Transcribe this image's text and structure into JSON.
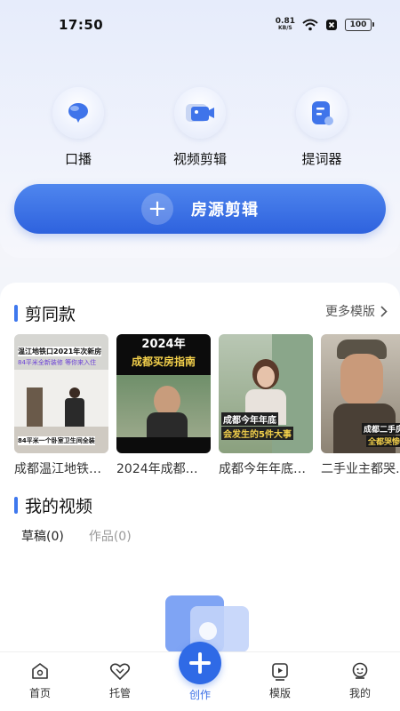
{
  "status": {
    "time": "17:50",
    "net_speed": "0.81",
    "net_unit": "KB/S",
    "battery": "100"
  },
  "tools": [
    {
      "label": "口播",
      "icon": "mic-bubble-icon"
    },
    {
      "label": "视频剪辑",
      "icon": "video-camera-icon"
    },
    {
      "label": "提词器",
      "icon": "teleprompter-icon"
    }
  ],
  "main_action": {
    "label": "房源剪辑",
    "icon": "plus-icon"
  },
  "templates_section": {
    "title": "剪同款",
    "more_label": "更多模版",
    "items": [
      {
        "title": "成都温江地铁…",
        "overlay_lines": [
          "温江地铁口2021年次新房",
          "84平米全新装修 等你来入住",
          "84平米一个卧室卫生间全装"
        ]
      },
      {
        "title": "2024年成都…",
        "overlay_lines": [
          "2024年",
          "成都买房指南"
        ]
      },
      {
        "title": "成都今年年底…",
        "overlay_lines": [
          "成都今年年底",
          "会发生的5件大事"
        ]
      },
      {
        "title": "二手业主都哭…",
        "overlay_lines": [
          "成都二手房东",
          "全都哭惨了"
        ]
      }
    ]
  },
  "videos_section": {
    "title": "我的视频",
    "tabs": [
      {
        "label": "草稿(0)",
        "active": true
      },
      {
        "label": "作品(0)",
        "active": false
      }
    ]
  },
  "nav": {
    "items": [
      {
        "label": "首页",
        "icon": "home-icon"
      },
      {
        "label": "托管",
        "icon": "handshake-icon"
      },
      {
        "label": "创作",
        "icon": "create-plus-icon",
        "active": true
      },
      {
        "label": "模版",
        "icon": "template-play-icon"
      },
      {
        "label": "我的",
        "icon": "profile-icon"
      }
    ]
  },
  "colors": {
    "accent": "#2f6ae6",
    "panel_bg": "#ffffff",
    "page_bg": "#f3f5fa"
  }
}
